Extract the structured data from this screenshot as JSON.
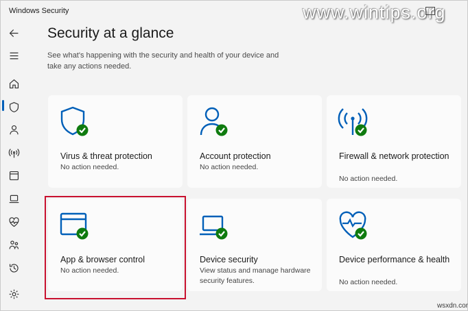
{
  "window": {
    "title": "Windows Security"
  },
  "watermark": "www.wintips.org",
  "credit": "wsxdn.com",
  "sidebar": {
    "items": [
      {
        "icon": "back-arrow-icon"
      },
      {
        "icon": "hamburger-menu-icon"
      },
      {
        "icon": "home-icon",
        "active": true
      },
      {
        "icon": "shield-icon"
      },
      {
        "icon": "person-icon"
      },
      {
        "icon": "wifi-antenna-icon"
      },
      {
        "icon": "app-window-icon"
      },
      {
        "icon": "laptop-icon"
      },
      {
        "icon": "heart-pulse-icon"
      },
      {
        "icon": "family-icon"
      },
      {
        "icon": "history-icon"
      },
      {
        "icon": "gear-icon"
      }
    ]
  },
  "main": {
    "title": "Security at a glance",
    "subtitle": "See what's happening with the security and health of your device and take any actions needed.",
    "cards": [
      {
        "title": "Virus & threat protection",
        "status": "No action needed.",
        "icon": "shield-check-icon"
      },
      {
        "title": "Account protection",
        "status": "No action needed.",
        "icon": "person-check-icon"
      },
      {
        "title": "Firewall & network protection",
        "status": "No action needed.",
        "icon": "antenna-check-icon"
      },
      {
        "title": "App & browser control",
        "status": "No action needed.",
        "icon": "browser-check-icon",
        "highlighted": true
      },
      {
        "title": "Device security",
        "status": "View status and manage hardware security features.",
        "icon": "laptop-check-icon"
      },
      {
        "title": "Device performance & health",
        "status": "No action needed.",
        "icon": "heart-check-icon"
      }
    ]
  },
  "colors": {
    "accent_blue": "#005fb8",
    "check_green": "#0f7b0f",
    "highlight_red": "#c8102e"
  }
}
